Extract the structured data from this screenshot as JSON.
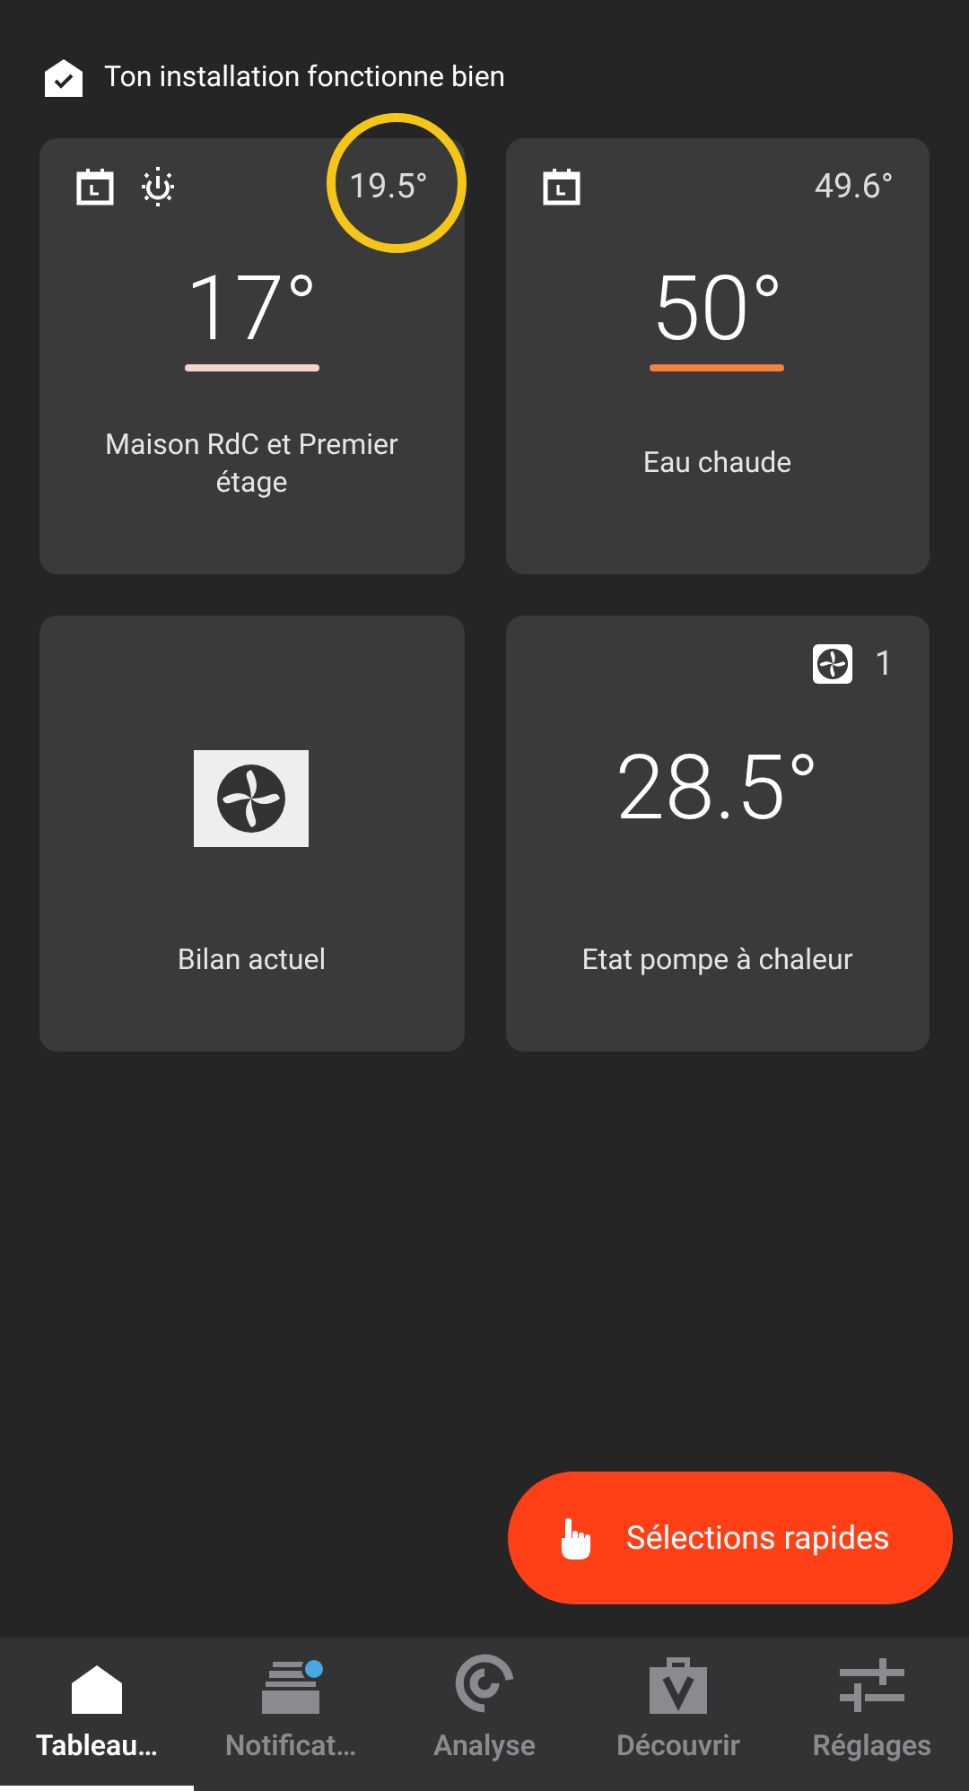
{
  "status": {
    "text": "Ton installation fonctionne bien"
  },
  "tiles": [
    {
      "kind": "heating",
      "reading": "19.5°",
      "highlighted": true,
      "value": "17°",
      "color": "#f7d3cc",
      "label": "Maison RdC et Premier étage"
    },
    {
      "kind": "hot-water",
      "reading": "49.6°",
      "highlighted": false,
      "value": "50°",
      "color": "#f5823a",
      "label": "Eau chaude"
    },
    {
      "kind": "fan",
      "label": "Bilan actuel"
    },
    {
      "kind": "pump",
      "count": "1",
      "value": "28.5°",
      "label": "Etat pompe à chaleur"
    }
  ],
  "fab": {
    "label": "Sélections rapides"
  },
  "nav": [
    {
      "label": "Tableau…",
      "selected": true,
      "badge": false
    },
    {
      "label": "Notificat…",
      "selected": false,
      "badge": true
    },
    {
      "label": "Analyse",
      "selected": false,
      "badge": false
    },
    {
      "label": "Découvrir",
      "selected": false,
      "badge": false
    },
    {
      "label": "Réglages",
      "selected": false,
      "badge": false
    }
  ]
}
